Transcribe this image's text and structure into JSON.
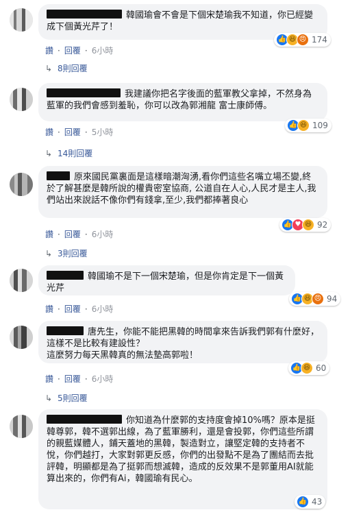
{
  "actions": {
    "like": "讚",
    "reply": "回覆"
  },
  "colors": {
    "bubble": "#f2f3f5",
    "link": "#385898",
    "like": "#1877f2",
    "haha": "#f7b125",
    "angry": "#e9710f",
    "love": "#f33e58"
  },
  "comments": [
    {
      "text": "韓國瑜會不會是下個宋楚瑜我不知道，你已經變成下個黃光芹了！",
      "reactions": [
        "like-icon",
        "haha-icon",
        "angry-icon"
      ],
      "count": "174",
      "time": "6小時",
      "replies": "8則回覆"
    },
    {
      "text": "我建議你把名字後面的藍軍教父拿掉，不然身為藍軍的我們會感到羞恥，你可以改為郭湘龍 富士康師傅。",
      "reactions": [
        "like-icon",
        "haha-icon"
      ],
      "count": "109",
      "time": "5小時",
      "replies": "14則回覆"
    },
    {
      "text": "原來國民黨裏面是這樣暗潮洶湧,看你們這些名嘴立場丕變,終於了解甚麼是韓所說的權貴密室協商, 公道自在人心,人民才是主人,我們站出來說話不像你們有錢拿,至少,我們都捧著良心",
      "reactions": [
        "like-icon",
        "love-icon",
        "haha-icon"
      ],
      "count": "92",
      "time": "6小時",
      "replies": "3則回覆"
    },
    {
      "text": "韓國瑜不是下一個宋楚瑜，但是你肯定是下一個黃光芹",
      "reactions": [
        "like-icon",
        "haha-icon",
        "angry-icon"
      ],
      "count": "94",
      "time": "6小時",
      "replies": ""
    },
    {
      "text": "唐先生，你能不能把黑韓的時間拿來告訴我們郭有什麼好，這樣不是比較有建設性？\n這麼努力每天黑韓真的無法墊高郭啦！",
      "reactions": [
        "like-icon",
        "haha-icon"
      ],
      "count": "60",
      "time": "6小時",
      "replies": "5則回覆"
    },
    {
      "text": "你知道為什麼郭的支持度會掉10%嗎？原本是挺韓尊郭，韓不選郭出線，為了藍軍勝利，還是會投郭，你們這些所謂的親藍媒體人，鋪天蓋地的黑韓，製造對立，讓堅定韓的支持者不悅，你們越打，大家對郭更反感，你們的出發點不是為了團結而去批評韓，明顯都是為了挺郭而想滅韓，造成的反效果不是郭董用AI就能算出來的，你們有Ai，韓國瑜有民心。",
      "reactions": [
        "like-icon"
      ],
      "count": "43",
      "time": "",
      "replies": ""
    }
  ]
}
